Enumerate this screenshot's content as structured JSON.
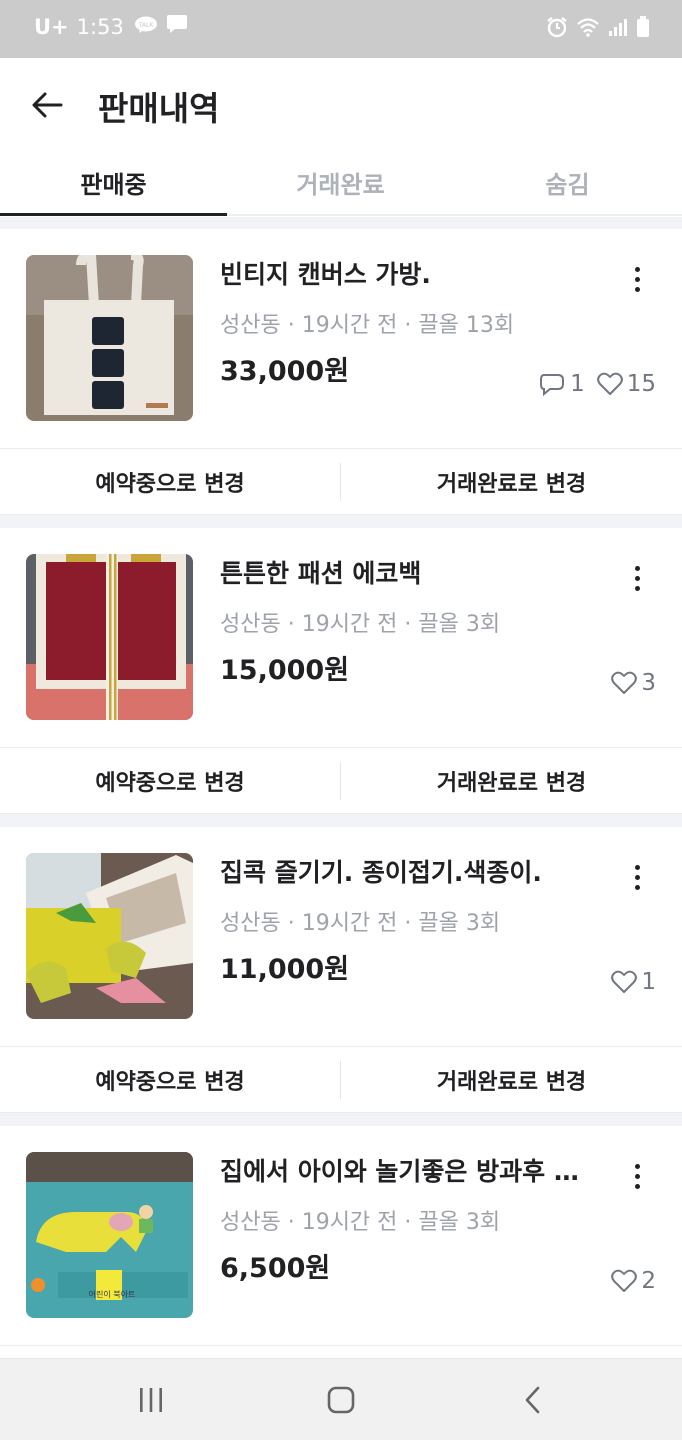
{
  "status_bar": {
    "carrier": "U+",
    "time": "1:53",
    "icons_left": [
      "talk-icon",
      "message-icon"
    ],
    "icons_right": [
      "alarm-icon",
      "wifi-icon",
      "signal-icon",
      "battery-icon"
    ]
  },
  "header": {
    "back_icon": "back-arrow-icon",
    "title": "판매내역"
  },
  "tabs": [
    {
      "label": "판매중",
      "active": true
    },
    {
      "label": "거래완료",
      "active": false
    },
    {
      "label": "숨김",
      "active": false
    }
  ],
  "items": [
    {
      "title": "빈티지 캔버스 가방.",
      "meta": "성산동 · 19시간 전 · 끌올 13회",
      "price": "33,000원",
      "chats": "1",
      "likes": "15",
      "actions": {
        "reserve": "예약중으로 변경",
        "complete": "거래완료로 변경"
      }
    },
    {
      "title": "튼튼한 패션 에코백",
      "meta": "성산동 · 19시간 전 · 끌올 3회",
      "price": "15,000원",
      "likes": "3",
      "actions": {
        "reserve": "예약중으로 변경",
        "complete": "거래완료로 변경"
      }
    },
    {
      "title": "집콕  즐기기. 종이접기.색종이.",
      "meta": "성산동 · 19시간 전 · 끌올 3회",
      "price": "11,000원",
      "likes": "1",
      "actions": {
        "reserve": "예약중으로 변경",
        "complete": "거래완료로 변경"
      }
    },
    {
      "title": "집에서 아이와 놀기좋은 방과후 어린이 북아트",
      "meta": "성산동 · 19시간 전 · 끌올 3회",
      "price": "6,500원",
      "likes": "2",
      "book_text": "어린이 북아트"
    }
  ],
  "navbar": {
    "icons": [
      "recent-apps-icon",
      "home-icon",
      "back-icon"
    ]
  },
  "colors": {
    "text_primary": "#212124",
    "text_secondary": "#9ea2a9",
    "status_bar_bg": "#cbcbcb",
    "divider_bg": "#f2f3f6"
  }
}
